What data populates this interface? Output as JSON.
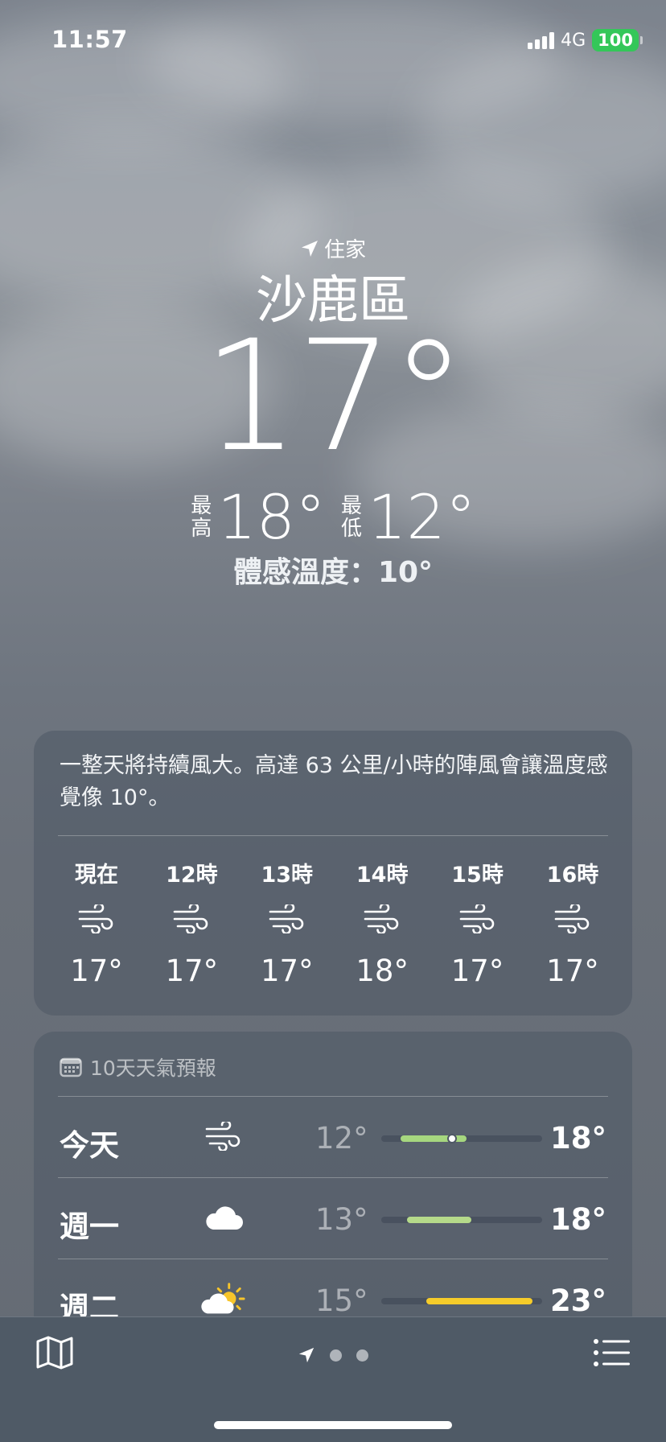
{
  "status_bar": {
    "time": "11:57",
    "network": "4G",
    "battery": "100",
    "battery_color": "#34c759"
  },
  "location": {
    "label": "住家",
    "city": "沙鹿區"
  },
  "current": {
    "temp": "17°",
    "high_label": "最高",
    "high": "18°",
    "low_label": "最低",
    "low": "12°",
    "feels_like": "體感溫度：10°"
  },
  "hourly": {
    "summary": "一整天將持續風大。高達 63 公里/小時的陣風會讓溫度感覺像 10°。",
    "hours": [
      {
        "label": "現在",
        "icon": "wind-icon",
        "temp": "17°"
      },
      {
        "label": "12時",
        "icon": "wind-icon",
        "temp": "17°"
      },
      {
        "label": "13時",
        "icon": "wind-icon",
        "temp": "17°"
      },
      {
        "label": "14時",
        "icon": "wind-icon",
        "temp": "18°"
      },
      {
        "label": "15時",
        "icon": "wind-icon",
        "temp": "17°"
      },
      {
        "label": "16時",
        "icon": "wind-icon",
        "temp": "17°"
      }
    ]
  },
  "daily": {
    "title": "10天天氣預報",
    "days": [
      {
        "day": "今天",
        "icon": "wind-icon",
        "low": "12°",
        "high": "18°",
        "range_start": 0.12,
        "range_end": 0.53,
        "current_marker": 0.44,
        "bar_color": "#a6d77f"
      },
      {
        "day": "週一",
        "icon": "cloud-icon",
        "low": "13°",
        "high": "18°",
        "range_start": 0.16,
        "range_end": 0.56,
        "bar_color": "#b5da8a"
      },
      {
        "day": "週二",
        "icon": "partly-sunny-icon",
        "low": "15°",
        "high": "23°",
        "range_start": 0.28,
        "range_end": 0.94,
        "bar_color": "#f6cc2a"
      }
    ]
  },
  "toolbar": {
    "map": "map-icon",
    "location": "location-arrow-icon",
    "list": "list-icon"
  }
}
